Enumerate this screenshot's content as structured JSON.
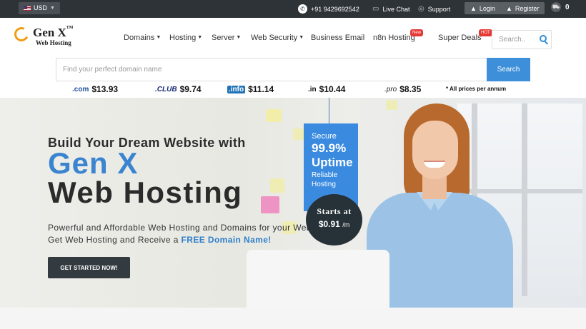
{
  "topbar": {
    "currency": "USD",
    "phone": "+91 9429692542",
    "live_chat": "Live Chat",
    "support": "Support",
    "login": "Login",
    "register": "Register",
    "cart_count": "0"
  },
  "logo": {
    "main": "Gen X",
    "tm": "TM",
    "sub": "Web Hosting"
  },
  "nav": {
    "items": [
      {
        "label": "Domains"
      },
      {
        "label": "Hosting"
      },
      {
        "label": "Server"
      },
      {
        "label": "Web Security"
      },
      {
        "label": "Business Email"
      },
      {
        "label": "n8n Hosting",
        "badge": "New"
      },
      {
        "label": "Super Deals",
        "badge": "HOT"
      }
    ],
    "search_placeholder": "Search.."
  },
  "domain_search": {
    "placeholder": "Find your perfect domain name",
    "button": "Search"
  },
  "prices": {
    "items": [
      {
        "tld": ".com",
        "price": "$13.93"
      },
      {
        "tld": ".CLUB",
        "price": "$9.74"
      },
      {
        "tld": ".info",
        "price": "$11.14"
      },
      {
        "tld": ".in",
        "price": "$10.44"
      },
      {
        "tld": ".pro",
        "price": "$8.35"
      }
    ],
    "note": "* All prices per annum"
  },
  "hero": {
    "subtitle": "Build Your Dream Website with",
    "title_accent": "Gen X",
    "title_main": "Web Hosting",
    "para1": "Powerful and Affordable Web Hosting and Domains for your Website.",
    "para2_prefix": "Get Web Hosting and Receive a ",
    "para2_highlight": "FREE Domain Name!",
    "cta": "GET STARTED NOW!"
  },
  "uptime_tag": {
    "line1": "Secure",
    "line2": "99.9%",
    "line3": "Uptime",
    "line4": "Reliable",
    "line5": "Hosting"
  },
  "starts_at": {
    "label": "Starts at",
    "price": "$0.91",
    "unit": "/m"
  },
  "colors": {
    "topbar": "#2e3338",
    "accent_blue": "#3a84d0",
    "tag_blue": "#3a8be0",
    "dark_button": "#333a40"
  }
}
